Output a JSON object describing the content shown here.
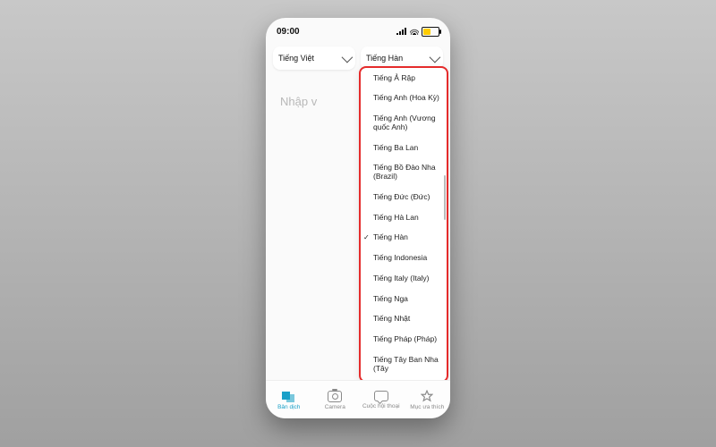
{
  "status": {
    "time": "09:00"
  },
  "selectors": {
    "source": "Tiếng Việt",
    "target": "Tiếng Hàn"
  },
  "input": {
    "placeholder_visible": "Nhập v"
  },
  "dropdown": {
    "selected_index": 7,
    "items": [
      "Tiếng Ả Rập",
      "Tiếng Anh (Hoa Kỳ)",
      "Tiếng Anh (Vương quốc Anh)",
      "Tiếng Ba Lan",
      "Tiếng Bồ Đào Nha (Brazil)",
      "Tiếng Đức (Đức)",
      "Tiếng Hà Lan",
      "Tiếng Hàn",
      "Tiếng Indonesia",
      "Tiếng Italy (Italy)",
      "Tiếng Nga",
      "Tiếng Nhật",
      "Tiếng Pháp (Pháp)",
      "Tiếng Tây Ban Nha (Tây"
    ]
  },
  "tabs": {
    "translate": "Bản dịch",
    "camera": "Camera",
    "conversation": "Cuộc hội thoại",
    "favorites": "Mục ưa thích"
  }
}
